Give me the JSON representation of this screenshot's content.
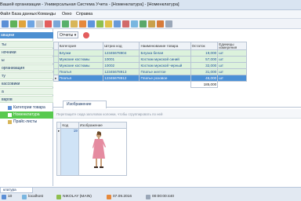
{
  "window": {
    "title": "Вашей организации - Универсальная Система Учета - [Номенклатура] - [Номенклатура]"
  },
  "menu": {
    "items": [
      "Файл",
      "База данных",
      "Команды",
      "Окно",
      "Справка"
    ]
  },
  "toolbar": {
    "buttons": [
      "back-icon",
      "forward-icon",
      "search-icon",
      "refresh-icon",
      "settings-icon",
      "filter-icon",
      "print-icon",
      "export-icon",
      "doc-icon",
      "chart-icon",
      "calendar-icon",
      "user-icon",
      "help-icon",
      "folder-icon",
      "home-icon",
      "mail-icon",
      "table-icon",
      "lock-icon",
      "star-icon",
      "window-icon"
    ]
  },
  "sidebar": {
    "header": "авщики",
    "items": [
      {
        "label": "ты",
        "style": "g"
      },
      {
        "label": "ночники",
        "style": "g"
      },
      {
        "label": "ы",
        "style": "g"
      },
      {
        "label": "организация",
        "style": "g"
      },
      {
        "label": "ту",
        "style": "g"
      },
      {
        "label": "кассовики",
        "style": "g"
      },
      {
        "label": "а",
        "style": "g"
      },
      {
        "label": "варов",
        "style": "g"
      }
    ],
    "subitems": [
      {
        "label": "Категории товара",
        "selected": false
      },
      {
        "label": "Номенклатура",
        "selected": true
      },
      {
        "label": "Прайс-листы",
        "selected": false
      }
    ]
  },
  "main": {
    "reports_label": "Отчеты",
    "columns": [
      "Категория",
      "Штрих код",
      "Наименование товара",
      "Остаток",
      "Единицы измерения"
    ],
    "rows": [
      [
        "Блузки",
        "12345678904",
        "Блузка белая",
        "19,000",
        "шт"
      ],
      [
        "Мужские костюмы",
        "10001",
        "Костюм мужской синий",
        "57,000",
        "шт"
      ],
      [
        "Мужские костюмы",
        "10002",
        "Костюм мужской черный",
        "32,000",
        "шт"
      ],
      [
        "Платья",
        "12345678913",
        "Платье желтое",
        "31,000",
        "шт"
      ],
      [
        "Платья",
        "12345678912",
        "Платье розовое",
        "46,000",
        "шт"
      ]
    ],
    "selected_row": 4,
    "total": "185,000"
  },
  "detail": {
    "tab_label": "Изображение",
    "group_hint": "Перетащите сюда заголовок колонки, чтобы сгруппировать по ней",
    "columns": [
      "Код",
      "Изображение"
    ],
    "code": "19"
  },
  "status": {
    "tab_label": "клатура",
    "values": [
      "10",
      "localhost",
      "NIKOLAY (MAIN)",
      "07.09.2016",
      "00:00:00:440"
    ]
  },
  "colors": {
    "accent": "#4a90d6",
    "selected_green": "#58c94f",
    "row_green": "#dcf2dc"
  }
}
